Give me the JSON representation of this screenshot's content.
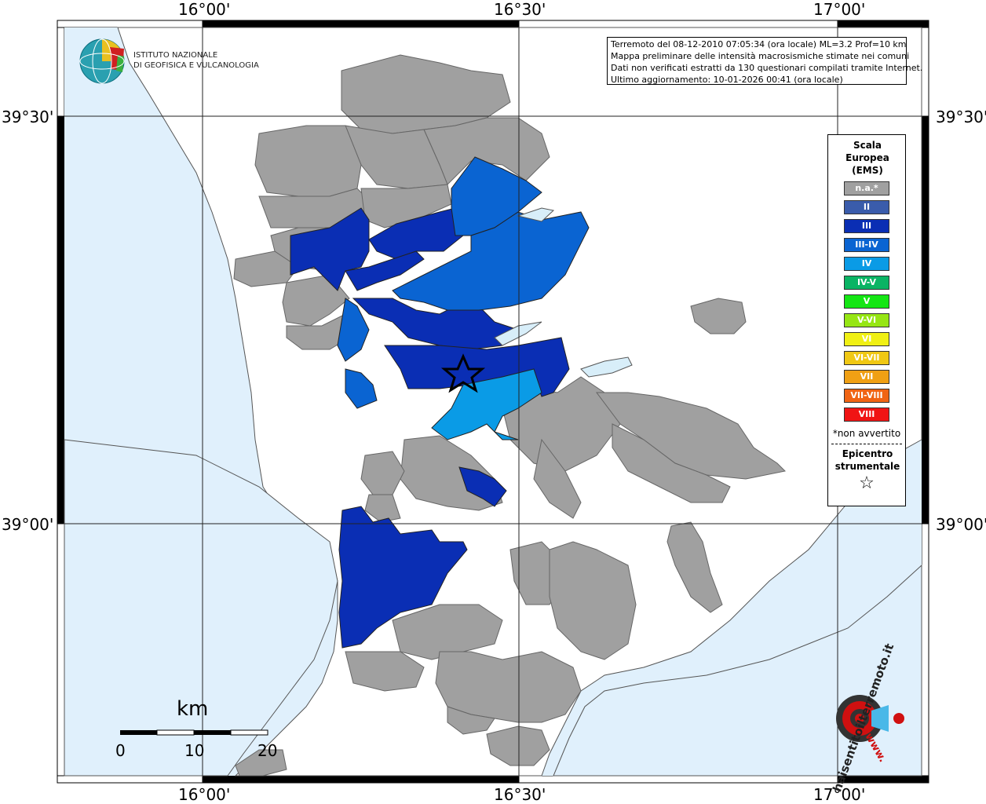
{
  "header": {
    "institute_line1": "ISTITUTO NAZIONALE",
    "institute_line2": "DI GEOFISICA E VULCANOLOGIA"
  },
  "info": {
    "line1": "Terremoto del 08-12-2010 07:05:34 (ora locale) ML=3.2 Prof=10 km",
    "line2": "Mappa preliminare delle intensità macrosismiche stimate nei comuni",
    "line3": "Dati non verificati estratti da 130 questionari compilati tramite Internet.",
    "line4": "Ultimo aggiornamento: 10-01-2026 00:41 (ora locale)"
  },
  "coords": {
    "top_1600": "16°00'",
    "top_1630": "16°30'",
    "top_1700": "17°00'",
    "bottom_1600": "16°00'",
    "bottom_1630": "16°30'",
    "bottom_1700": "17°00'",
    "left_3930": "39°30'",
    "left_3900": "39°00'",
    "right_3930": "39°30'",
    "right_3900": "39°00'"
  },
  "legend": {
    "title": "Scala Europea (EMS)",
    "items": [
      {
        "label": "n.a.*",
        "color": "#a0a0a0"
      },
      {
        "label": "II",
        "color": "#3a5cab"
      },
      {
        "label": "III",
        "color": "#0a2eb4"
      },
      {
        "label": "III-IV",
        "color": "#0a64d2"
      },
      {
        "label": "IV",
        "color": "#0a9be6"
      },
      {
        "label": "IV-V",
        "color": "#0ab464"
      },
      {
        "label": "V",
        "color": "#14e614"
      },
      {
        "label": "V-VI",
        "color": "#96e614"
      },
      {
        "label": "VI",
        "color": "#f0f014"
      },
      {
        "label": "VI-VII",
        "color": "#f0c814"
      },
      {
        "label": "VII",
        "color": "#f0a014"
      },
      {
        "label": "VII-VIII",
        "color": "#f06414"
      },
      {
        "label": "VIII",
        "color": "#f01414"
      }
    ],
    "note": "*non avvertito",
    "epicenter_label": "Epicentro strumentale",
    "epicenter_symbol": "☆"
  },
  "scale": {
    "unit": "km",
    "labels": [
      "0",
      "10",
      "20"
    ]
  },
  "logo_hsi": {
    "text": "haisentitoilterremoto.it",
    "prefix": "www."
  },
  "colors": {
    "sea": "#e0f0fc",
    "land": "#ffffff",
    "na": "#a0a0a0",
    "III": "#0a2eb4",
    "III-IV": "#0a64d2",
    "IV": "#0a9be6",
    "lake": "#d8eef9"
  }
}
